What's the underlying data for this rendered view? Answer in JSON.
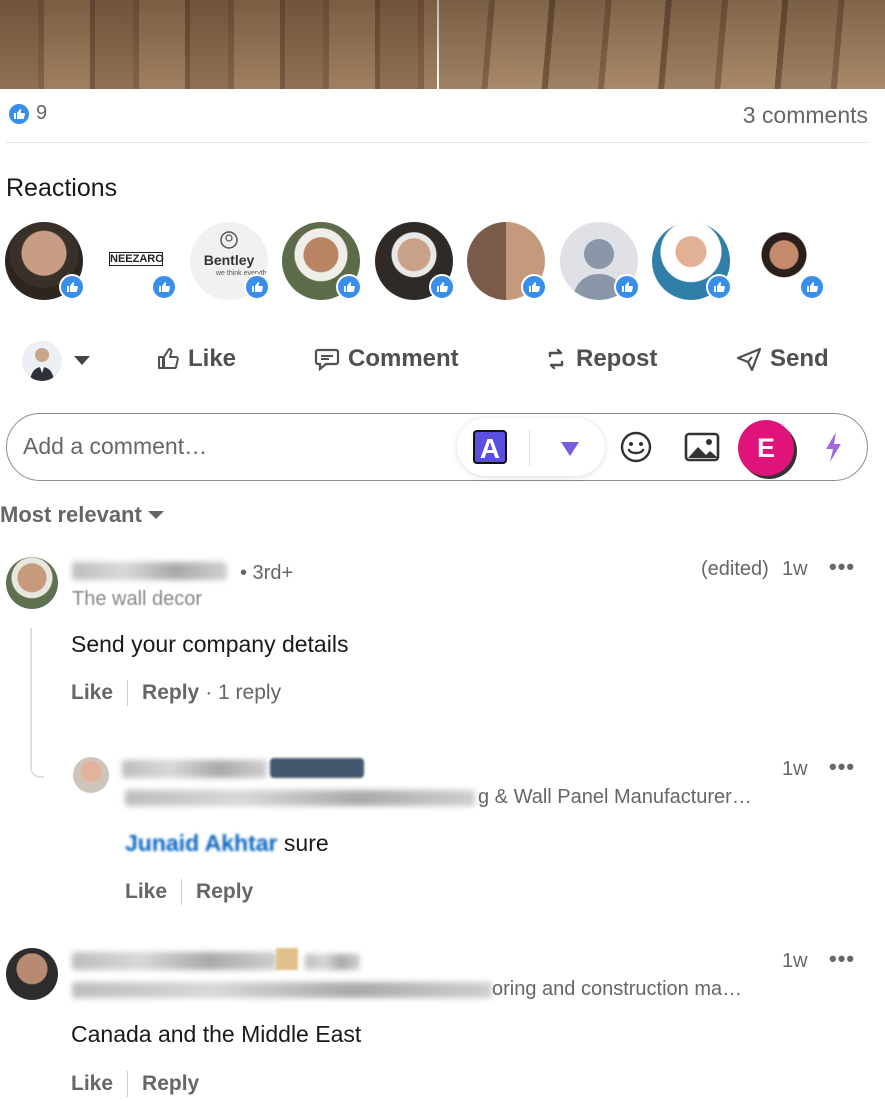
{
  "post": {
    "reaction_count": "9",
    "comments_count": "3 comments"
  },
  "reactions_section": {
    "title": "Reactions",
    "avatars": [
      {
        "name": "reactor-1"
      },
      {
        "name": "reactor-neezaro",
        "text": "NEEZARO"
      },
      {
        "name": "reactor-bentley",
        "text": "Bentley",
        "subtext": "we think everyth"
      },
      {
        "name": "reactor-4"
      },
      {
        "name": "reactor-5"
      },
      {
        "name": "reactor-6"
      },
      {
        "name": "reactor-7"
      },
      {
        "name": "reactor-8"
      },
      {
        "name": "reactor-9"
      }
    ],
    "reaction_icon": "like-icon"
  },
  "actions": {
    "like": "Like",
    "comment": "Comment",
    "repost": "Repost",
    "send": "Send"
  },
  "comment_input": {
    "placeholder": "Add a comment…",
    "extension_letter": "A",
    "profile_letter": "E"
  },
  "sort": {
    "label": "Most relevant"
  },
  "comments": [
    {
      "degree": "• 3rd+",
      "headline": "The wall decor",
      "edited": "(edited)",
      "time": "1w",
      "text": "Send your company details",
      "like": "Like",
      "reply": "Reply",
      "reply_count": "· 1 reply",
      "replies": [
        {
          "headline_tail": "g & Wall Panel Manufacturer…",
          "time": "1w",
          "mention": "Junaid Akhtar",
          "text": " sure",
          "like": "Like",
          "reply": "Reply"
        }
      ]
    },
    {
      "headline_tail": "oring and construction ma…",
      "time": "1w",
      "text": "Canada and the Middle East",
      "like": "Like",
      "reply": "Reply"
    }
  ],
  "colors": {
    "like_blue": "#378fe9",
    "link_blue": "#0a66c2",
    "profile_pink": "#e0137a",
    "extension_purple": "#5b4fe0"
  }
}
